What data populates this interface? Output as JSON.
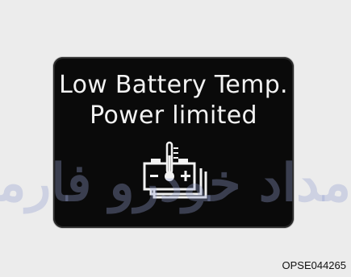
{
  "display": {
    "line1": "Low Battery Temp.",
    "line2": "Power limited",
    "icon": "battery-temperature-icon",
    "text_color": "#f2f2f2",
    "background_color": "#0a0a0a"
  },
  "watermark": {
    "text": "مداد خودرو فارما"
  },
  "figure_code": "OPSE044265"
}
